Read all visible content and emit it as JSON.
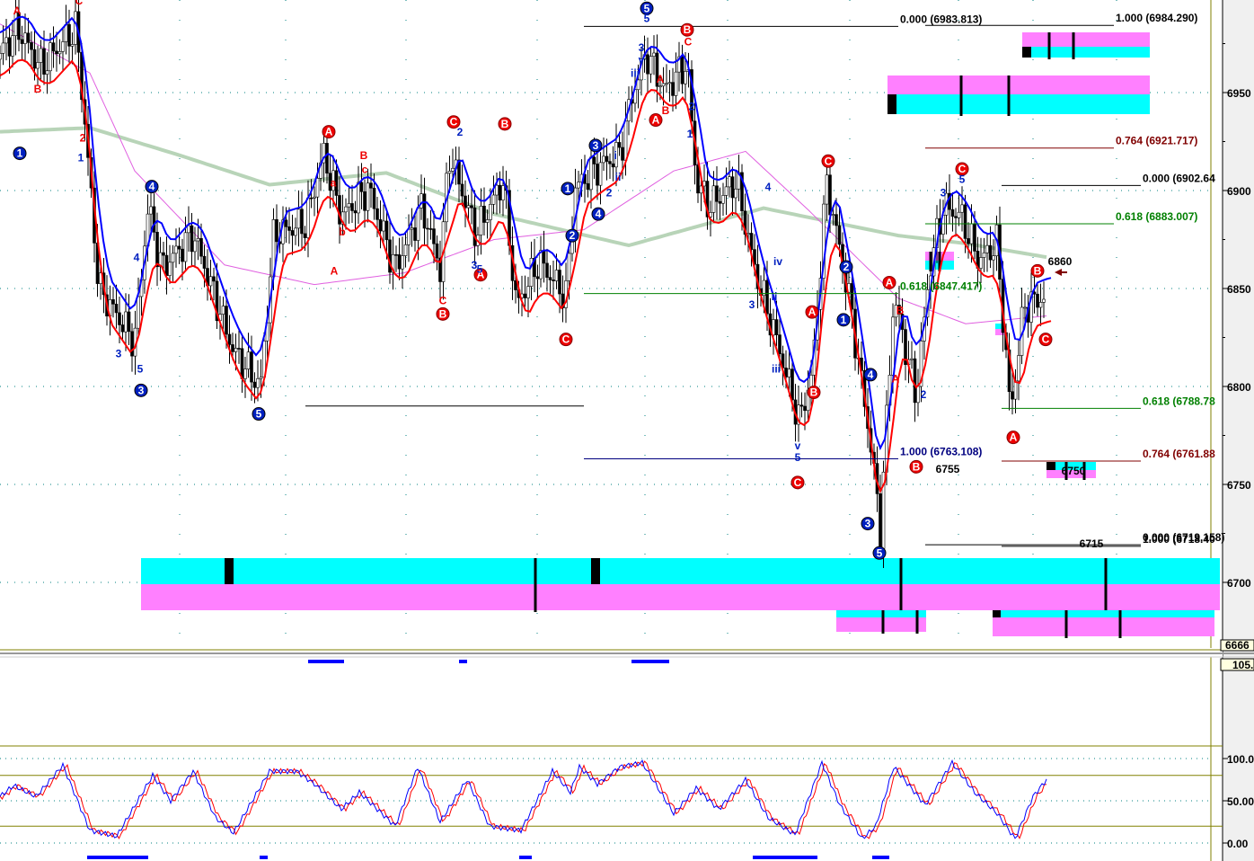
{
  "chart_data": {
    "type": "line",
    "title": "",
    "price_axis": {
      "ticks": [
        6950,
        6900,
        6850,
        6800,
        6750,
        6700
      ],
      "tick_labels": [
        "6950",
        "6900",
        "6850",
        "6800",
        "6750",
        "6700"
      ],
      "range": [
        6666,
        6990
      ],
      "current_box": "6666"
    },
    "osc_axis": {
      "ticks": [
        100,
        50,
        0
      ],
      "tick_labels": [
        "100.0",
        "50.00",
        "0.00"
      ],
      "range": [
        0,
        105
      ],
      "current_box": "105.",
      "bands": [
        20,
        80
      ]
    },
    "price_path": {
      "bar": [
        0,
        4,
        9,
        17,
        20,
        22,
        30,
        33,
        36,
        43,
        52,
        58,
        61,
        68,
        72,
        76,
        82,
        88,
        94,
        98,
        100,
        106,
        112,
        115,
        120,
        126,
        128,
        132,
        138,
        141,
        144,
        148,
        153,
        155,
        158,
        164,
        168,
        173,
        178,
        181,
        184,
        189,
        194,
        196,
        199,
        204,
        207,
        210,
        214,
        218,
        222,
        225,
        228,
        233
      ],
      "price": [
        6970,
        6983,
        6963,
        6983,
        6905,
        6850,
        6823,
        6892,
        6860,
        6878,
        6818,
        6800,
        6878,
        6883,
        6919,
        6887,
        6901,
        6860,
        6892,
        6860,
        6919,
        6878,
        6905,
        6841,
        6864,
        6846,
        6901,
        6910,
        6919,
        6951,
        6970,
        6951,
        6965,
        6905,
        6892,
        6905,
        6860,
        6823,
        6782,
        6809,
        6905,
        6846,
        6768,
        6727,
        6846,
        6795,
        6860,
        6892,
        6887,
        6864,
        6873,
        6786,
        6841,
        6846
      ]
    },
    "ma_slow": {
      "bar": [
        0,
        20,
        40,
        60,
        86,
        110,
        140,
        170,
        200,
        215,
        233
      ],
      "price": [
        6930,
        6932,
        6918,
        6903,
        6909,
        6888,
        6872,
        6891,
        6877,
        6873,
        6866
      ]
    },
    "ma_fast": {
      "bar": [
        0,
        20,
        30,
        50,
        70,
        90,
        110,
        130,
        150,
        166,
        180,
        200,
        215,
        233
      ],
      "price": [
        6985,
        6960,
        6910,
        6862,
        6852,
        6858,
        6875,
        6880,
        6910,
        6920,
        6890,
        6845,
        6832,
        6836
      ]
    },
    "stochastic": {
      "bar": [
        0,
        3,
        8,
        14,
        20,
        26,
        34,
        38,
        43,
        48,
        52,
        60,
        66,
        70,
        76,
        80,
        88,
        93,
        98,
        104,
        109,
        116,
        123,
        127,
        129,
        133,
        138,
        143,
        150,
        155,
        160,
        166,
        171,
        177,
        183,
        187,
        192,
        195,
        199,
        206,
        212,
        217,
        222,
        226,
        230,
        233
      ],
      "k": [
        55,
        68,
        55,
        92,
        15,
        8,
        80,
        50,
        85,
        30,
        12,
        85,
        85,
        70,
        40,
        60,
        20,
        90,
        25,
        75,
        20,
        15,
        85,
        60,
        90,
        70,
        90,
        95,
        35,
        65,
        40,
        75,
        30,
        10,
        95,
        45,
        5,
        20,
        90,
        45,
        95,
        60,
        35,
        5,
        55,
        75
      ]
    },
    "fib_levels": [
      {
        "label": "0.000 (6983.813)",
        "price": 6983.8,
        "from": 130,
        "to": 200,
        "color": "#000000"
      },
      {
        "label": "1.000 (6984.290)",
        "price": 6984.3,
        "from": 206,
        "to": 248,
        "color": "#000000"
      },
      {
        "label": "0.764 (6921.717)",
        "price": 6921.7,
        "from": 206,
        "to": 248,
        "color": "#800000"
      },
      {
        "label": "0.000 (6902.64",
        "price": 6902.6,
        "from": 223,
        "to": 254,
        "color": "#000000"
      },
      {
        "label": "0.618 (6883.007)",
        "price": 6883.0,
        "from": 206,
        "to": 248,
        "color": "#008000"
      },
      {
        "label": "0.618 (6847.417)",
        "price": 6847.4,
        "from": 130,
        "to": 200,
        "color": "#008000"
      },
      {
        "label": "0.618 (6788.78",
        "price": 6788.8,
        "from": 223,
        "to": 254,
        "color": "#008000"
      },
      {
        "label": "1.000 (6763.108)",
        "price": 6763.1,
        "from": 130,
        "to": 200,
        "color": "#000080"
      },
      {
        "label": "0.764 (6761.88",
        "price": 6761.9,
        "from": 223,
        "to": 254,
        "color": "#800000"
      },
      {
        "label": "0.000 (6719.158)",
        "price": 6719.2,
        "from": 206,
        "to": 254,
        "color": "#000000"
      },
      {
        "label": "1.000 (6718.40",
        "price": 6718.4,
        "from": 223,
        "to": 254,
        "color": "#000000"
      }
    ],
    "plain_lines": [
      {
        "price": 6790,
        "from": 68,
        "to": 130
      }
    ],
    "price_labels": [
      {
        "text": "6860",
        "bar": 236,
        "price": 6862
      },
      {
        "text": "6755",
        "bar": 211,
        "price": 6756
      },
      {
        "text": "6750",
        "bar": 239,
        "price": 6755
      },
      {
        "text": "6715",
        "bar": 243,
        "price": 6718
      }
    ],
    "wave_circles": [
      {
        "t": "1",
        "c": "blue",
        "bar": 4.4,
        "price": 6919
      },
      {
        "t": "3",
        "c": "blue",
        "bar": 31.4,
        "price": 6798
      },
      {
        "t": "4",
        "c": "blue",
        "bar": 33.8,
        "price": 6902
      },
      {
        "t": "5",
        "c": "blue",
        "bar": 57.6,
        "price": 6786
      },
      {
        "t": "1",
        "c": "blue",
        "bar": 126.4,
        "price": 6901
      },
      {
        "t": "2",
        "c": "blue",
        "bar": 127.4,
        "price": 6877
      },
      {
        "t": "3",
        "c": "blue",
        "bar": 132.6,
        "price": 6923
      },
      {
        "t": "4",
        "c": "blue",
        "bar": 133.2,
        "price": 6888
      },
      {
        "t": "5",
        "c": "blue",
        "bar": 144,
        "price": 6993
      },
      {
        "t": "1",
        "c": "blue",
        "bar": 187.8,
        "price": 6834
      },
      {
        "t": "2",
        "c": "blue",
        "bar": 188.4,
        "price": 6861
      },
      {
        "t": "4",
        "c": "blue",
        "bar": 193.8,
        "price": 6806
      },
      {
        "t": "3",
        "c": "blue",
        "bar": 193.2,
        "price": 6730
      },
      {
        "t": "5",
        "c": "blue",
        "bar": 195.8,
        "price": 6715
      },
      {
        "t": "A",
        "c": "red",
        "bar": 73.2,
        "price": 6930
      },
      {
        "t": "C",
        "c": "red",
        "bar": 101,
        "price": 6935
      },
      {
        "t": "B",
        "c": "red",
        "bar": 112.4,
        "price": 6934
      },
      {
        "t": "B",
        "c": "red",
        "bar": 98.6,
        "price": 6837
      },
      {
        "t": "A",
        "c": "red",
        "bar": 107,
        "price": 6857
      },
      {
        "t": "C",
        "c": "red",
        "bar": 126,
        "price": 6824
      },
      {
        "t": "B",
        "c": "red",
        "bar": 153,
        "price": 6982
      },
      {
        "t": "A",
        "c": "red",
        "bar": 146,
        "price": 6936
      },
      {
        "t": "C",
        "c": "red",
        "bar": 184.4,
        "price": 6915
      },
      {
        "t": "A",
        "c": "red",
        "bar": 180.8,
        "price": 6838
      },
      {
        "t": "B",
        "c": "red",
        "bar": 181.2,
        "price": 6797
      },
      {
        "t": "C",
        "c": "red",
        "bar": 177.6,
        "price": 6751
      },
      {
        "t": "A",
        "c": "red",
        "bar": 198,
        "price": 6853
      },
      {
        "t": "B",
        "c": "red",
        "bar": 204,
        "price": 6759
      },
      {
        "t": "C",
        "c": "red",
        "bar": 214.2,
        "price": 6911
      },
      {
        "t": "B",
        "c": "red",
        "bar": 231,
        "price": 6859
      },
      {
        "t": "C",
        "c": "red",
        "bar": 232.8,
        "price": 6824
      },
      {
        "t": "A",
        "c": "red",
        "bar": 225.6,
        "price": 6774
      }
    ],
    "wave_text": [
      {
        "t": "C",
        "c": "red",
        "bar": 17.6,
        "price": 6995
      },
      {
        "t": "B",
        "c": "red",
        "bar": 8.4,
        "price": 6950
      },
      {
        "t": "A",
        "c": "red",
        "bar": 3.8,
        "price": 6990
      },
      {
        "t": "B",
        "c": "red",
        "bar": 81,
        "price": 6916
      },
      {
        "t": "c",
        "c": "red",
        "bar": 81.2,
        "price": 6909
      },
      {
        "t": "a",
        "c": "red",
        "bar": 74.2,
        "price": 6902
      },
      {
        "t": "b",
        "c": "red",
        "bar": 76.2,
        "price": 6877
      },
      {
        "t": "A",
        "c": "red",
        "bar": 74.4,
        "price": 6857
      },
      {
        "t": "C",
        "c": "red",
        "bar": 98.6,
        "price": 6842
      },
      {
        "t": "C",
        "c": "red",
        "bar": 153.2,
        "price": 6974
      },
      {
        "t": "B",
        "c": "red",
        "bar": 148.2,
        "price": 6939
      },
      {
        "t": "A",
        "c": "red",
        "bar": 147,
        "price": 6955
      },
      {
        "t": "B",
        "c": "red",
        "bar": 200.4,
        "price": 6837
      },
      {
        "t": "A",
        "c": "red",
        "bar": 199.4,
        "price": 6802
      },
      {
        "t": "2",
        "c": "red",
        "bar": 18.4,
        "price": 6925
      },
      {
        "t": "1",
        "c": "blue",
        "bar": 18,
        "price": 6915
      },
      {
        "t": "3",
        "c": "blue",
        "bar": 26.4,
        "price": 6815
      },
      {
        "t": "4",
        "c": "blue",
        "bar": 30.4,
        "price": 6864
      },
      {
        "t": "5",
        "c": "blue",
        "bar": 31.2,
        "price": 6807
      },
      {
        "t": "2",
        "c": "blue",
        "bar": 102.4,
        "price": 6928
      },
      {
        "t": "3",
        "c": "blue",
        "bar": 105.6,
        "price": 6860
      },
      {
        "t": "5",
        "c": "blue",
        "bar": 106.8,
        "price": 6858
      },
      {
        "t": "i",
        "c": "blue",
        "bar": 137,
        "price": 6916
      },
      {
        "t": "ii",
        "c": "blue",
        "bar": 137.6,
        "price": 6905
      },
      {
        "t": "2",
        "c": "blue",
        "bar": 135.6,
        "price": 6897
      },
      {
        "t": "iii",
        "c": "blue",
        "bar": 141.4,
        "price": 6958
      },
      {
        "t": "v",
        "c": "blue",
        "bar": 142.8,
        "price": 6965
      },
      {
        "t": "3",
        "c": "blue",
        "bar": 142.8,
        "price": 6971
      },
      {
        "t": "5",
        "c": "blue",
        "bar": 144,
        "price": 6986
      },
      {
        "t": "2",
        "c": "blue",
        "bar": 154,
        "price": 6941
      },
      {
        "t": "1",
        "c": "blue",
        "bar": 153.6,
        "price": 6927
      },
      {
        "t": "4",
        "c": "blue",
        "bar": 171,
        "price": 6900
      },
      {
        "t": "iv",
        "c": "blue",
        "bar": 173.2,
        "price": 6862
      },
      {
        "t": "ii",
        "c": "blue",
        "bar": 172.4,
        "price": 6844
      },
      {
        "t": "3",
        "c": "blue",
        "bar": 167.4,
        "price": 6840
      },
      {
        "t": "iii",
        "c": "blue",
        "bar": 172.8,
        "price": 6807
      },
      {
        "t": "v",
        "c": "blue",
        "bar": 177.6,
        "price": 6768
      },
      {
        "t": "5",
        "c": "blue",
        "bar": 177.6,
        "price": 6762
      },
      {
        "t": "3",
        "c": "blue",
        "bar": 210,
        "price": 6897
      },
      {
        "t": "5",
        "c": "blue",
        "bar": 214.2,
        "price": 6904
      },
      {
        "t": "2",
        "c": "blue",
        "bar": 205.6,
        "price": 6794
      }
    ]
  },
  "colors": {
    "blue_band": "#0000ff",
    "red_band": "#ff0000",
    "ma_slow": "#b8d4b8",
    "ma_fast": "#e060e0",
    "cyan": "#00ffff",
    "magenta": "#ff80ff",
    "olive": "#808000",
    "grid": "#008080"
  }
}
